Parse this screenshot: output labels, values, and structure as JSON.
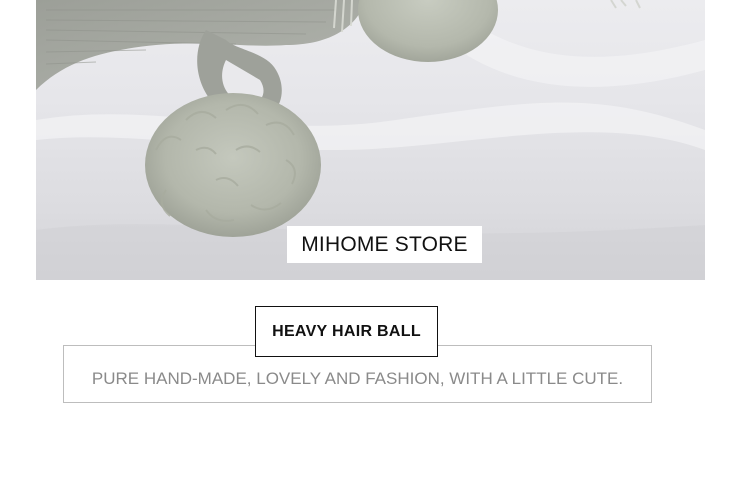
{
  "photo": {
    "store_label": "MIHOME STORE"
  },
  "feature": {
    "title": "HEAVY HAIR BALL",
    "description": "PURE HAND-MADE, LOVELY AND FASHION, WITH A LITTLE CUTE."
  },
  "colors": {
    "background": "#ffffff",
    "title_text": "#111111",
    "description_text": "#8a8a8a",
    "description_border": "#bdbdbd",
    "pompom": "#b9bdb2",
    "knit": "#a5a8a1"
  }
}
